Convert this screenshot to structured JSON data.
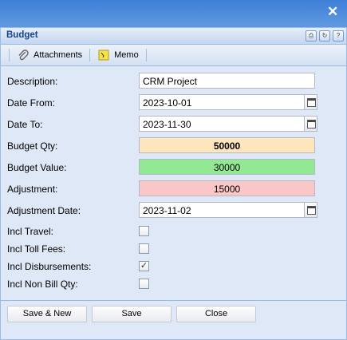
{
  "window": {
    "close_icon": "close-icon"
  },
  "panel": {
    "title": "Budget"
  },
  "toolbar": {
    "attachments_label": "Attachments",
    "memo_label": "Memo"
  },
  "form": {
    "description": {
      "label": "Description:",
      "value": "CRM Project"
    },
    "date_from": {
      "label": "Date From:",
      "value": "2023-10-01"
    },
    "date_to": {
      "label": "Date To:",
      "value": "2023-11-30"
    },
    "budget_qty": {
      "label": "Budget Qty:",
      "value": "50000"
    },
    "budget_value": {
      "label": "Budget Value:",
      "value": "30000"
    },
    "adjustment": {
      "label": "Adjustment:",
      "value": "15000"
    },
    "adjustment_date": {
      "label": "Adjustment Date:",
      "value": "2023-11-02"
    },
    "incl_travel": {
      "label": "Incl Travel:",
      "checked": false
    },
    "incl_toll_fees": {
      "label": "Incl Toll Fees:",
      "checked": false
    },
    "incl_disbursements": {
      "label": "Incl Disbursements:",
      "checked": true,
      "mark": "✓"
    },
    "incl_non_bill_qty": {
      "label": "Incl Non Bill Qty:",
      "checked": false
    }
  },
  "buttons": {
    "save_new": "Save & New",
    "save": "Save",
    "close": "Close"
  },
  "colors": {
    "qty_bg": "#fde6bb",
    "value_bg": "#93e893",
    "adjustment_bg": "#f9c7c7"
  }
}
